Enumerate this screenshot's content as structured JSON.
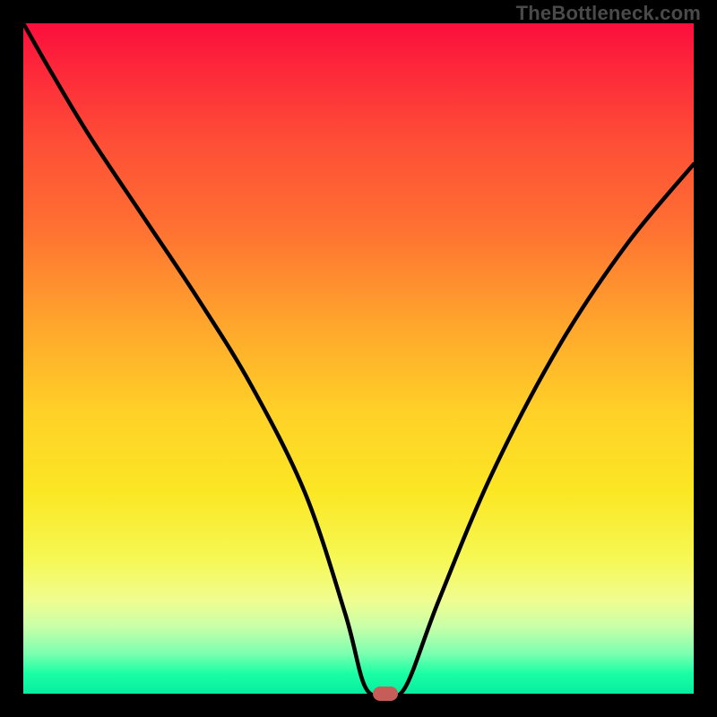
{
  "watermark": "TheBottleneck.com",
  "colors": {
    "background": "#000000",
    "gradient_top": "#fc0e3c",
    "gradient_bottom": "#06eda0",
    "curve": "#000000",
    "marker": "#c65d59",
    "watermark_text": "#4a4a4a"
  },
  "chart_data": {
    "type": "line",
    "title": "",
    "xlabel": "",
    "ylabel": "",
    "xlim": [
      0,
      100
    ],
    "ylim": [
      0,
      100
    ],
    "background_gradient": {
      "orientation": "vertical",
      "meaning": "bottleneck severity (red=high at top, green=low at bottom)",
      "stops": [
        {
          "pos": 0,
          "color": "#fc0e3c"
        },
        {
          "pos": 50,
          "color": "#ffd127"
        },
        {
          "pos": 85,
          "color": "#f0fd8f"
        },
        {
          "pos": 100,
          "color": "#06eda0"
        }
      ]
    },
    "series": [
      {
        "name": "bottleneck-curve",
        "color": "#000000",
        "x": [
          0,
          4,
          10,
          18,
          26,
          34,
          42,
          48,
          51,
          54,
          57,
          62,
          70,
          80,
          90,
          100
        ],
        "y": [
          100,
          93,
          83,
          71,
          59,
          46,
          30,
          12,
          1,
          0,
          1,
          14,
          33,
          52,
          67,
          79
        ]
      }
    ],
    "marker": {
      "x": 54,
      "y": 0,
      "shape": "rounded-rect",
      "color": "#c65d59"
    }
  }
}
